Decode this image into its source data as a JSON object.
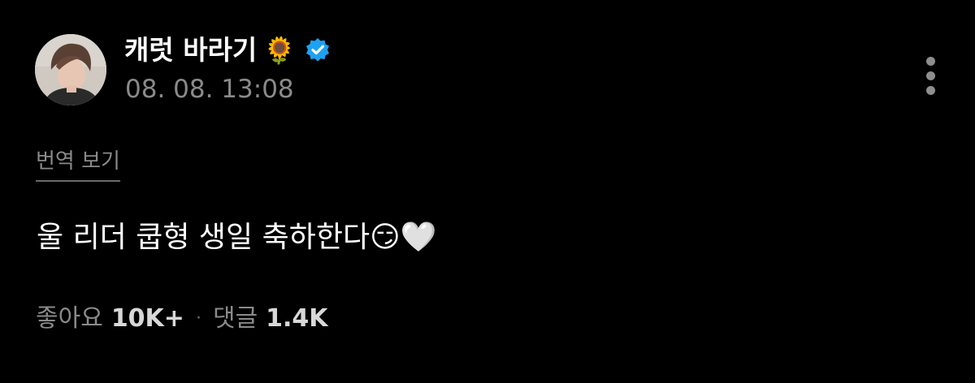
{
  "post": {
    "author": {
      "name": "캐럿 바라기",
      "name_emoji": "🌻",
      "verified": true,
      "verified_color": "#1da1f2",
      "avatar": "profile-photo"
    },
    "timestamp": "08. 08. 13:08",
    "menu_icon": "more-vertical-icon",
    "translate_label": "번역 보기",
    "body": "울 리더 쿱형 생일 축하한다😏🤍",
    "stats": {
      "likes_label": "좋아요",
      "likes_value": "10K+",
      "separator": "·",
      "comments_label": "댓글",
      "comments_value": "1.4K"
    }
  },
  "colors": {
    "background": "#000000",
    "primary_text": "#ffffff",
    "secondary_text": "#8a8a8a"
  }
}
